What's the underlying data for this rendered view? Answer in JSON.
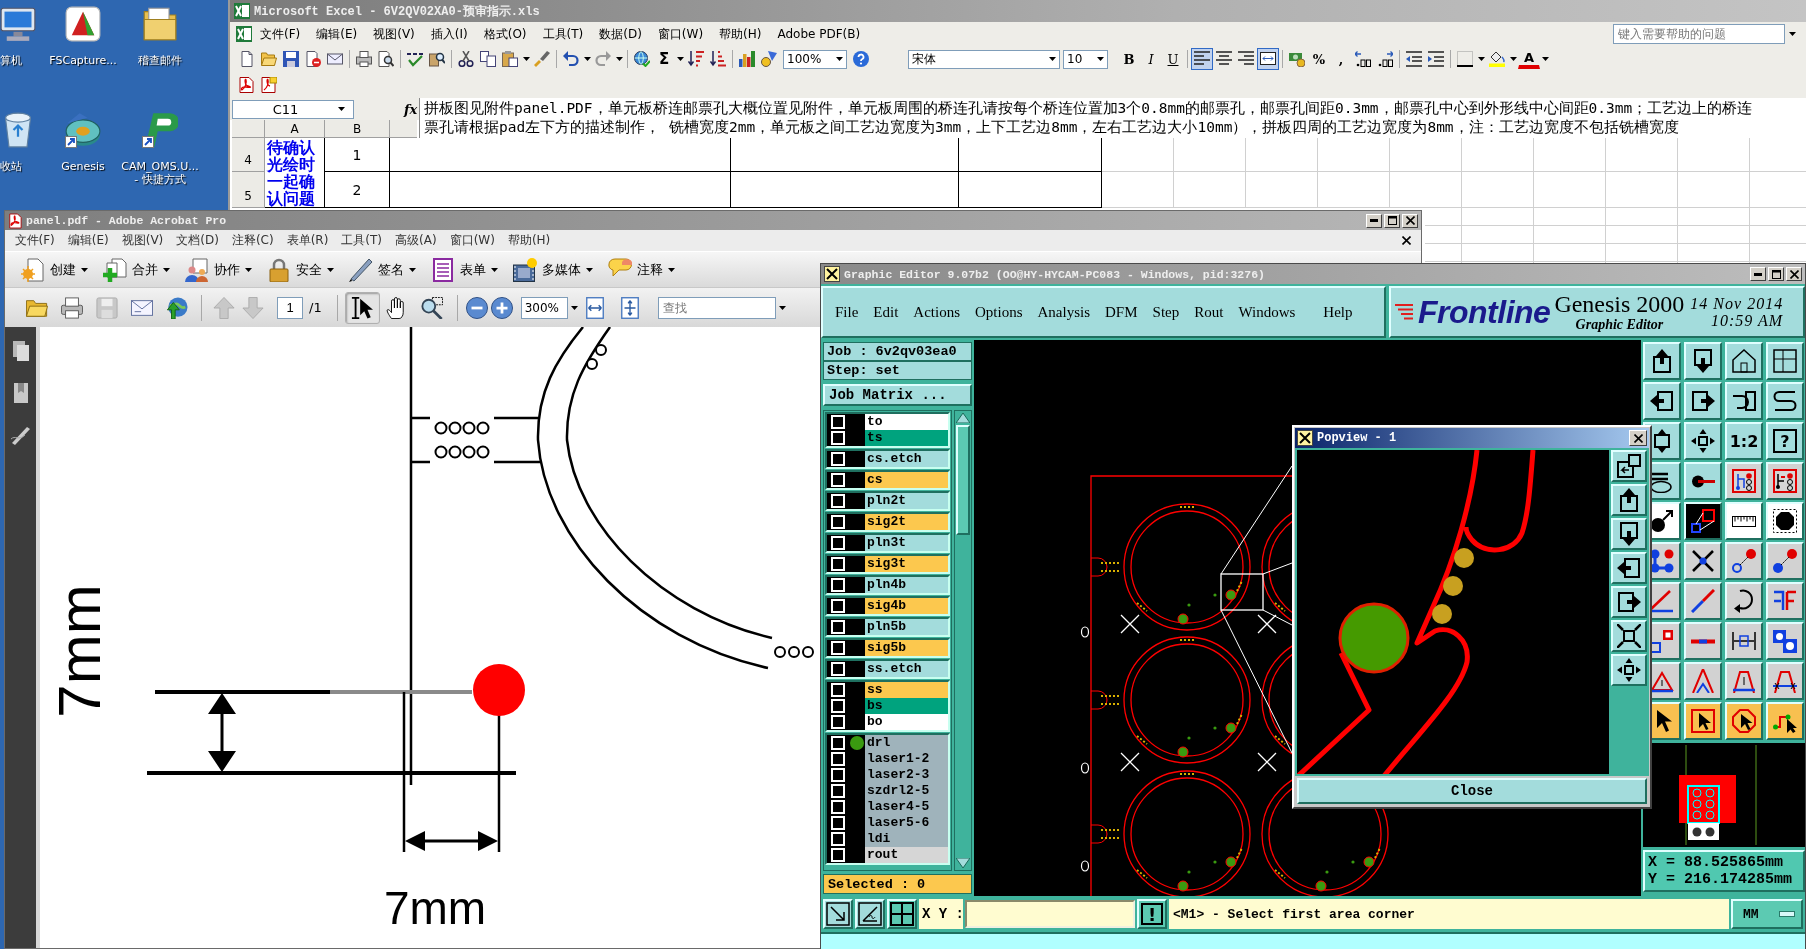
{
  "desktop": {
    "icons": [
      {
        "kind": "computer",
        "label_lines": [
          "算机"
        ],
        "shortcut": false
      },
      {
        "kind": "capture",
        "label_lines": [
          "FSCapture..."
        ],
        "shortcut": false
      },
      {
        "kind": "folder",
        "label_lines": [
          "稽查邮件"
        ],
        "shortcut": false
      },
      {
        "kind": "recycle-bin",
        "label_lines": [
          "收站"
        ],
        "shortcut": false
      },
      {
        "kind": "disc",
        "label_lines": [
          "Genesis"
        ],
        "shortcut": true
      },
      {
        "kind": "logo",
        "label_lines": [
          "CAM_OMS.U...",
          "- 快捷方式"
        ],
        "shortcut": true
      }
    ]
  },
  "excel": {
    "title": "Microsoft Excel - 6V2QV02XA0-预审指示.xls",
    "menu": [
      "文件(F)",
      "编辑(E)",
      "视图(V)",
      "插入(I)",
      "格式(O)",
      "工具(T)",
      "数据(D)",
      "窗口(W)",
      "帮助(H)",
      "Adobe PDF(B)"
    ],
    "help_box": {
      "placeholder": "键入需要帮助的问题"
    },
    "toolbar": {
      "autosum": "Σ",
      "zoom": "100%",
      "font": "宋体",
      "font_size": "10",
      "style_buttons": [
        {
          "kind": "bold",
          "label": "B"
        },
        {
          "kind": "italic",
          "label": "I"
        },
        {
          "kind": "underline",
          "label": "U"
        }
      ],
      "align_buttons": [
        {
          "kind": "left",
          "selected": true
        },
        {
          "kind": "center",
          "selected": false
        },
        {
          "kind": "right",
          "selected": false
        },
        {
          "kind": "merge",
          "selected": true
        }
      ],
      "number_buttons": [
        "%",
        ","
      ],
      "font_color": "A"
    },
    "name_box": "C11",
    "function_button": "fx",
    "formula_lines": [
      "拼板图见附件panel.PDF，单元板桥连邮票孔大概位置见附件，单元板周围的桥连孔请按每个桥连位置加3个0.8mm的邮票孔，邮票孔间距0.3mm，邮票孔中心到外形线中心间距0.3mm；工艺边上的桥连",
      "票孔请根据pad左下方的描述制作， 铣槽宽度2mm，单元板之间工艺边宽度为3mm，上下工艺边8mm，左右工艺边大小10mm），拼板四周的工艺边宽度为8mm，注：工艺边宽度不包括铣槽宽度"
    ],
    "columns": [
      "A",
      "B"
    ],
    "merged_cell": "待确认光绘时一起确认问题",
    "rows": [
      {
        "header": "4",
        "value": "1"
      },
      {
        "header": "5",
        "value": "2"
      }
    ]
  },
  "acrobat": {
    "title": "panel.pdf - Adobe Acrobat Pro",
    "menu": [
      "文件(F)",
      "编辑(E)",
      "视图(V)",
      "文档(D)",
      "注释(C)",
      "表单(R)",
      "工具(T)",
      "高级(A)",
      "窗口(W)",
      "帮助(H)"
    ],
    "tasks": [
      {
        "kind": "create",
        "label": "创建"
      },
      {
        "kind": "combine",
        "label": "合并"
      },
      {
        "kind": "collaborate",
        "label": "协作"
      },
      {
        "kind": "secure",
        "label": "安全"
      },
      {
        "kind": "sign",
        "label": "签名"
      },
      {
        "kind": "forms",
        "label": "表单"
      },
      {
        "kind": "multimedia",
        "label": "多媒体"
      },
      {
        "kind": "comment",
        "label": "注释"
      }
    ],
    "page": {
      "value": "1",
      "total": "/1"
    },
    "tools": [
      {
        "kind": "select",
        "selected": true
      },
      {
        "kind": "hand",
        "selected": false
      },
      {
        "kind": "zoom",
        "selected": false
      }
    ],
    "zoom": "300%",
    "search": {
      "placeholder": "查找"
    },
    "dimension_labels": {
      "vertical": "7mm",
      "horizontal": "7mm"
    }
  },
  "genesis": {
    "title": "Graphic Editor 9.07b2 (OO@HY-HYCAM-PC083 - Windows, pid:3276)",
    "menu": [
      "File",
      "Edit",
      "Actions",
      "Options",
      "Analysis",
      "DFM",
      "Step",
      "Rout",
      "Windows",
      "Help"
    ],
    "brand": "Frontline",
    "product": "Genesis 2000",
    "module": "Graphic Editor",
    "date": "14 Nov 2014",
    "time": "10:59 AM",
    "job": "Job : 6v2qv03ea0",
    "step": "Step: set",
    "job_matrix": "Job Matrix ...",
    "layer_groups": [
      [
        {
          "name": "to",
          "color": "#ffffff",
          "checked": false,
          "displayed": false
        },
        {
          "name": "ts",
          "color": "#00a37e",
          "checked": false,
          "displayed": false
        }
      ],
      [
        {
          "name": "cs.etch",
          "color": "#a3dcdc",
          "checked": false,
          "displayed": false
        }
      ],
      [
        {
          "name": "cs",
          "color": "#fcc84e",
          "checked": false,
          "displayed": false
        }
      ],
      [
        {
          "name": "pln2t",
          "color": "#a3dcdc",
          "checked": false,
          "displayed": false
        }
      ],
      [
        {
          "name": "sig2t",
          "color": "#fcc84e",
          "checked": false,
          "displayed": false
        }
      ],
      [
        {
          "name": "pln3t",
          "color": "#a3dcdc",
          "checked": false,
          "displayed": false
        }
      ],
      [
        {
          "name": "sig3t",
          "color": "#fcc84e",
          "checked": false,
          "displayed": false
        }
      ],
      [
        {
          "name": "pln4b",
          "color": "#a3dcdc",
          "checked": false,
          "displayed": false
        }
      ],
      [
        {
          "name": "sig4b",
          "color": "#fcc84e",
          "checked": false,
          "displayed": false
        }
      ],
      [
        {
          "name": "pln5b",
          "color": "#a3dcdc",
          "checked": false,
          "displayed": false
        }
      ],
      [
        {
          "name": "sig5b",
          "color": "#fcc84e",
          "checked": false,
          "displayed": false
        }
      ],
      [
        {
          "name": "ss.etch",
          "color": "#a3dcdc",
          "checked": false,
          "displayed": false
        }
      ],
      [
        {
          "name": "ss",
          "color": "#fcc84e",
          "checked": false,
          "displayed": false
        },
        {
          "name": "bs",
          "color": "#00a37e",
          "checked": false,
          "displayed": false
        },
        {
          "name": "bo",
          "color": "#ffffff",
          "checked": false,
          "displayed": false
        }
      ],
      [
        {
          "name": "drl",
          "color": "#9fb3bb",
          "checked": false,
          "displayed": true
        },
        {
          "name": "laser1-2",
          "color": "#9fb3bb",
          "checked": false,
          "displayed": false
        },
        {
          "name": "laser2-3",
          "color": "#9fb3bb",
          "checked": false,
          "displayed": false
        },
        {
          "name": "szdrl2-5",
          "color": "#9fb3bb",
          "checked": false,
          "displayed": false
        },
        {
          "name": "laser4-5",
          "color": "#9fb3bb",
          "checked": false,
          "displayed": false
        },
        {
          "name": "laser5-6",
          "color": "#9fb3bb",
          "checked": false,
          "displayed": false
        },
        {
          "name": "ldi",
          "color": "#9fb3bb",
          "checked": false,
          "displayed": false
        },
        {
          "name": "rout",
          "color": "#d6d6d6",
          "checked": false,
          "displayed": false
        }
      ]
    ],
    "selected": "Selected : 0",
    "tool_labels": [
      "1:2",
      "?"
    ],
    "coordinates": [
      "X = 88.525865mm",
      "Y = 216.174285mm"
    ],
    "xy_label": "X Y :",
    "confirm": "!",
    "message": "<M1> - Select first area corner",
    "units": "MM",
    "popview": {
      "title": "Popview - 1",
      "close": "Close"
    }
  }
}
